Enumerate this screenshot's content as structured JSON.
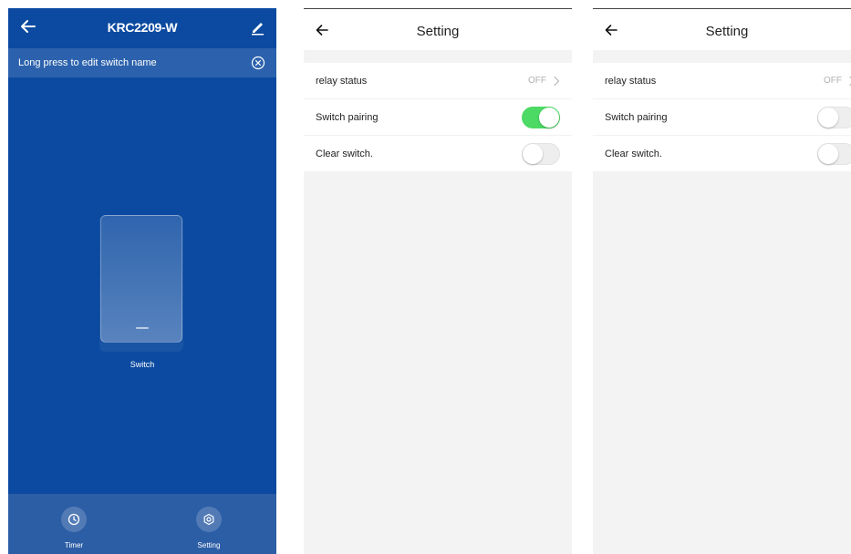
{
  "device_screen": {
    "title": "KRC2209-W",
    "banner_text": "Long press to edit switch name",
    "switch_label": "Switch",
    "nav": [
      {
        "label": "Timer",
        "icon": "clock-icon"
      },
      {
        "label": "Setting",
        "icon": "settings-icon"
      }
    ],
    "colors": {
      "background": "#0b4aa0",
      "banner": "#2c62ad",
      "bottom_bar": "#2c5ea6"
    }
  },
  "settings_a": {
    "title": "Setting",
    "rows": [
      {
        "label": "relay status",
        "value": "OFF"
      },
      {
        "label": "Switch pairing",
        "toggle": true
      },
      {
        "label": "Clear switch.",
        "toggle": false
      }
    ]
  },
  "settings_b": {
    "title": "Setting",
    "rows": [
      {
        "label": "relay status",
        "value": "OFF"
      },
      {
        "label": "Switch pairing",
        "toggle": false
      },
      {
        "label": "Clear switch.",
        "toggle": false
      }
    ]
  },
  "colors": {
    "toggle_on": "#4cd964",
    "toggle_off": "#eeeeee"
  }
}
